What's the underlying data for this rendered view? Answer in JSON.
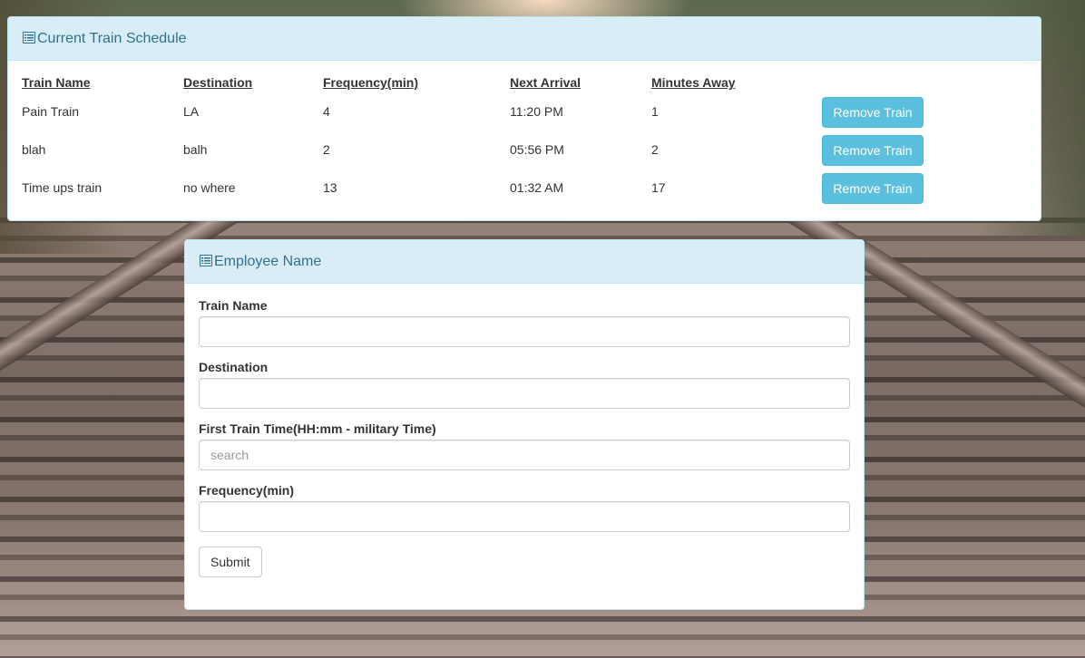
{
  "schedule": {
    "title": "Current Train Schedule",
    "headers": [
      "Train Name",
      "Destination",
      "Frequency(min)",
      "Next Arrival",
      "Minutes Away"
    ],
    "rows": [
      {
        "name": "Pain Train",
        "destination": "LA",
        "frequency": "4",
        "next_arrival": "11:20 PM",
        "minutes_away": "1",
        "action": "Remove Train"
      },
      {
        "name": "blah",
        "destination": "balh",
        "frequency": "2",
        "next_arrival": "05:56 PM",
        "minutes_away": "2",
        "action": "Remove Train"
      },
      {
        "name": "Time ups train",
        "destination": "no where",
        "frequency": "13",
        "next_arrival": "01:32 AM",
        "minutes_away": "17",
        "action": "Remove Train"
      }
    ]
  },
  "form": {
    "title": "Employee Name",
    "fields": [
      {
        "label": "Train Name",
        "value": "",
        "placeholder": ""
      },
      {
        "label": "Destination",
        "value": "",
        "placeholder": ""
      },
      {
        "label": "First Train Time(HH:mm - military Time)",
        "value": "",
        "placeholder": "search"
      },
      {
        "label": "Frequency(min)",
        "value": "",
        "placeholder": ""
      }
    ],
    "submit_label": "Submit"
  },
  "colors": {
    "panel_heading_bg": "#d9edf7",
    "panel_heading_text": "#31708f",
    "info_button": "#5bc0de"
  },
  "icons": {
    "panel_heading": "list-alt-icon"
  }
}
